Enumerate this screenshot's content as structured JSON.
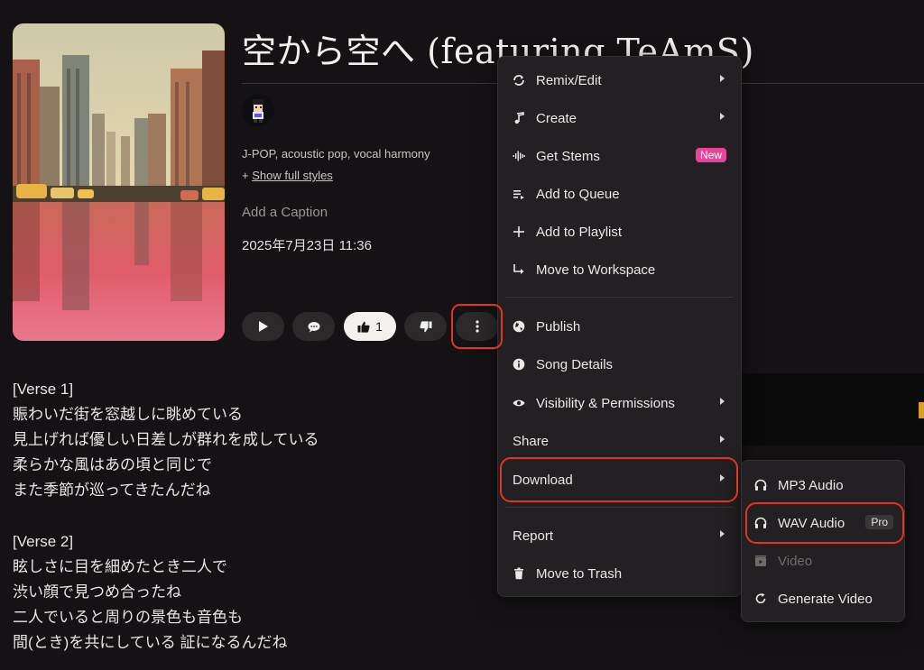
{
  "song": {
    "title": "空から空へ (featuring TeAmS)",
    "styles": "J-POP, acoustic pop, vocal harmony",
    "show_styles_prefix": "+",
    "show_styles_label": "Show full styles",
    "caption_placeholder": "Add a Caption",
    "date": "2025年7月23日 11:36",
    "like_count": "1"
  },
  "lyrics": [
    "[Verse 1]",
    "賑わいだ街を窓越しに眺めている",
    "見上げれば優しい日差しが群れを成している",
    "柔らかな風はあの頃と同じで",
    "また季節が巡ってきたんだね",
    "",
    "[Verse 2]",
    "眩しさに目を細めたとき二人で",
    "渋い顔で見つめ合ったね",
    "二人でいると周りの景色も音色も",
    "間(とき)を共にしている 証になるんだね"
  ],
  "menu": {
    "items": [
      {
        "label": "Remix/Edit",
        "icon": "remix-icon"
      },
      {
        "label": "Create",
        "icon": "music-note-icon"
      },
      {
        "label": "Get Stems",
        "icon": "waveform-icon",
        "badge": "New"
      },
      {
        "label": "Add to Queue",
        "icon": "queue-icon"
      },
      {
        "label": "Add to Playlist",
        "icon": "plus-icon"
      },
      {
        "label": "Move to Workspace",
        "icon": "arrow-return-icon"
      },
      {
        "label": "Publish",
        "icon": "globe-icon"
      },
      {
        "label": "Song Details",
        "icon": "info-icon"
      },
      {
        "label": "Visibility & Permissions",
        "icon": "eye-icon"
      },
      {
        "label": "Share"
      },
      {
        "label": "Download"
      },
      {
        "label": "Report"
      },
      {
        "label": "Move to Trash",
        "icon": "trash-icon"
      }
    ]
  },
  "download_submenu": {
    "items": [
      {
        "label": "MP3 Audio",
        "icon": "headphones-icon"
      },
      {
        "label": "WAV Audio",
        "icon": "headphones-icon",
        "badge": "Pro"
      },
      {
        "label": "Video",
        "icon": "video-icon",
        "disabled": true
      },
      {
        "label": "Generate Video",
        "icon": "refresh-icon"
      }
    ]
  },
  "colors": {
    "background": "#141214",
    "menu_bg": "#222022",
    "highlight": "#e5331f",
    "new_badge": "#e8449a"
  }
}
